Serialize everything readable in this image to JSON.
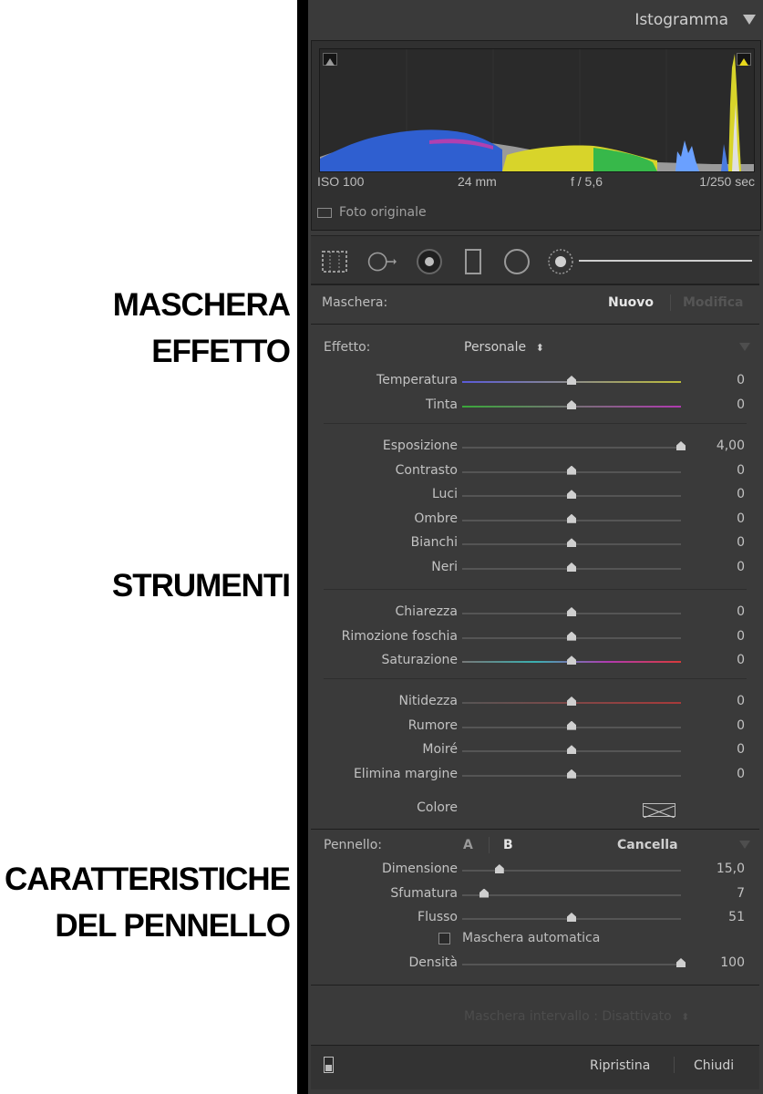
{
  "annotations": {
    "mask_effect": [
      "MASCHERA",
      "EFFETTO"
    ],
    "tools": "STRUMENTI",
    "brush": [
      "CARATTERISTICHE",
      "DEL PENNELLO"
    ]
  },
  "histogram": {
    "title": "Istogramma",
    "iso": "ISO 100",
    "focal": "24 mm",
    "aperture": "f / 5,6",
    "shutter": "1/250 sec",
    "original_photo": "Foto originale"
  },
  "mask": {
    "label": "Maschera:",
    "new": "Nuovo",
    "edit": "Modifica"
  },
  "effect": {
    "label": "Effetto:",
    "preset": "Personale",
    "preset_arrows": "⬍",
    "groups": [
      [
        {
          "label": "Temperatura",
          "value": "0",
          "pos": 0.5,
          "gradient": "temp"
        },
        {
          "label": "Tinta",
          "value": "0",
          "pos": 0.5,
          "gradient": "tint"
        }
      ],
      [
        {
          "label": "Esposizione",
          "value": "4,00",
          "pos": 1.0
        },
        {
          "label": "Contrasto",
          "value": "0",
          "pos": 0.5
        },
        {
          "label": "Luci",
          "value": "0",
          "pos": 0.5
        },
        {
          "label": "Ombre",
          "value": "0",
          "pos": 0.5
        },
        {
          "label": "Bianchi",
          "value": "0",
          "pos": 0.5
        },
        {
          "label": "Neri",
          "value": "0",
          "pos": 0.5
        }
      ],
      [
        {
          "label": "Chiarezza",
          "value": "0",
          "pos": 0.5
        },
        {
          "label": "Rimozione foschia",
          "value": "0",
          "pos": 0.5
        },
        {
          "label": "Saturazione",
          "value": "0",
          "pos": 0.5,
          "gradient": "sat"
        }
      ],
      [
        {
          "label": "Nitidezza",
          "value": "0",
          "pos": 0.5,
          "gradient": "sharp"
        },
        {
          "label": "Rumore",
          "value": "0",
          "pos": 0.5
        },
        {
          "label": "Moiré",
          "value": "0",
          "pos": 0.5
        },
        {
          "label": "Elimina margine",
          "value": "0",
          "pos": 0.5
        }
      ]
    ],
    "color_label": "Colore"
  },
  "brush": {
    "label": "Pennello:",
    "a": "A",
    "b": "B",
    "erase": "Cancella",
    "sliders": [
      {
        "label": "Dimensione",
        "value": "15,0",
        "pos": 0.17
      },
      {
        "label": "Sfumatura",
        "value": "7",
        "pos": 0.1
      },
      {
        "label": "Flusso",
        "value": "51",
        "pos": 0.5
      }
    ],
    "auto_mask": "Maschera automatica",
    "density": {
      "label": "Densità",
      "value": "100",
      "pos": 1.0
    }
  },
  "range_mask": "Maschera intervallo : Disattivato",
  "footer": {
    "reset": "Ripristina",
    "close": "Chiudi"
  },
  "colors": {
    "panel_bg": "#3a3a3a",
    "text": "#cfcfcf",
    "histogram_blue": "#2f5fd0",
    "histogram_yellow": "#d8d42a",
    "histogram_green": "#37b84a",
    "clip_warning": "#e8d81c"
  }
}
